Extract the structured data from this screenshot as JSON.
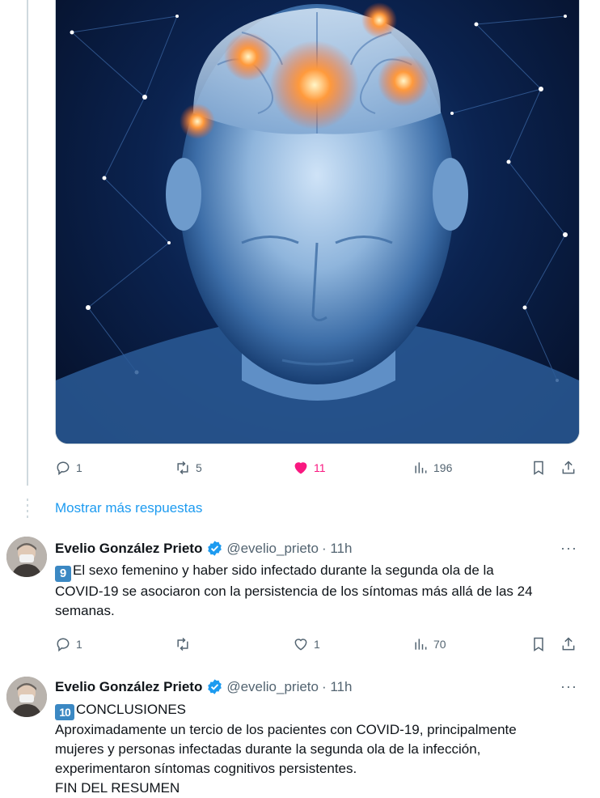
{
  "top_tweet": {
    "image_alt": "brain-illustration",
    "actions": {
      "replies": "1",
      "retweets": "5",
      "likes": "11",
      "views": "196"
    }
  },
  "show_more_label": "Mostrar más respuestas",
  "tweets": [
    {
      "name": "Evelio González Prieto",
      "handle": "@evelio_prieto",
      "time": "· 11h",
      "more": "···",
      "badge": "9",
      "lines": [
        "El sexo femenino y haber sido infectado durante la segunda ola de la",
        "COVID-19 se asociaron con la persistencia de los síntomas más allá de las 24",
        "semanas."
      ],
      "actions": {
        "replies": "1",
        "retweets": "",
        "likes": "1",
        "views": "70"
      }
    },
    {
      "name": "Evelio González Prieto",
      "handle": "@evelio_prieto",
      "time": "· 11h",
      "more": "···",
      "badge": "10",
      "lines": [
        "CONCLUSIONES",
        "Aproximadamente un tercio de los pacientes con COVID-19, principalmente",
        "mujeres y personas infectadas durante la segunda ola de la infección,",
        "experimentaron síntomas cognitivos persistentes.",
        "FIN DEL RESUMEN"
      ]
    }
  ],
  "colors": {
    "accent": "#1d9bf0",
    "like": "#f91880",
    "muted": "#536471"
  }
}
